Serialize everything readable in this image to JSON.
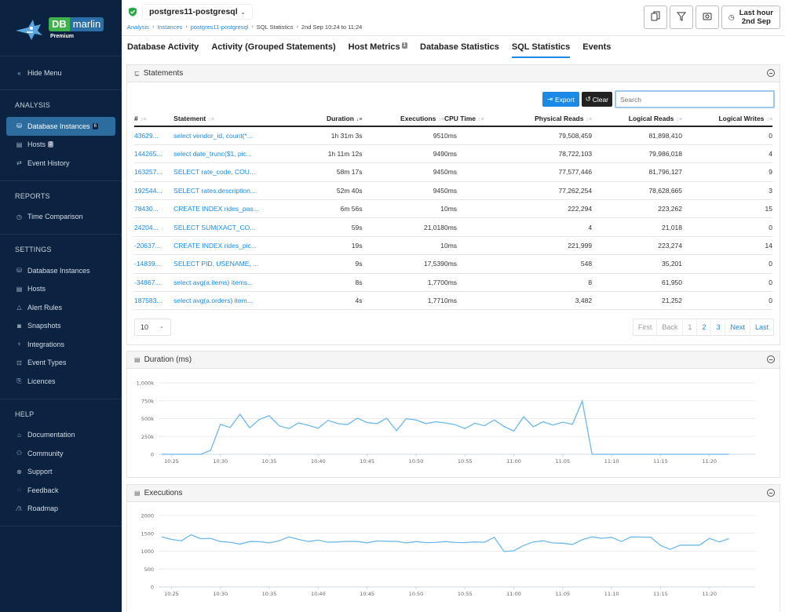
{
  "sidebar": {
    "logo": {
      "db": "DB",
      "marlin": "marlin",
      "tier": "Premium"
    },
    "hide_menu": "Hide Menu",
    "sections": [
      {
        "title": "ANALYSIS",
        "items": [
          {
            "label": "Database Instances",
            "icon": "database-icon",
            "badge": "6",
            "active": true
          },
          {
            "label": "Hosts",
            "icon": "server-icon",
            "badge": "2"
          },
          {
            "label": "Event History",
            "icon": "arrows-exchange-icon"
          }
        ]
      },
      {
        "title": "REPORTS",
        "items": [
          {
            "label": "Time Comparison",
            "icon": "stopwatch-icon"
          }
        ]
      },
      {
        "title": "SETTINGS",
        "items": [
          {
            "label": "Database Instances",
            "icon": "database-icon"
          },
          {
            "label": "Hosts",
            "icon": "server-icon"
          },
          {
            "label": "Alert Rules",
            "icon": "warning-icon"
          },
          {
            "label": "Snapshots",
            "icon": "camera-icon"
          },
          {
            "label": "Integrations",
            "icon": "plug-icon"
          },
          {
            "label": "Event Types",
            "icon": "event-types-icon"
          },
          {
            "label": "Licences",
            "icon": "licence-icon"
          }
        ]
      },
      {
        "title": "HELP",
        "items": [
          {
            "label": "Documentation",
            "icon": "documentation-icon"
          },
          {
            "label": "Community",
            "icon": "community-icon"
          },
          {
            "label": "Support",
            "icon": "globe-icon"
          },
          {
            "label": "Feedback",
            "icon": "chat-icon"
          },
          {
            "label": "Roadmap",
            "icon": "road-icon"
          }
        ]
      }
    ]
  },
  "header": {
    "instance": "postgres11-postgresql",
    "breadcrumb": [
      {
        "label": "Analysis",
        "link": true
      },
      {
        "label": "Instances",
        "link": true
      },
      {
        "label": "postgres11-postgresql",
        "link": true
      },
      {
        "label": "SQL Statistics",
        "link": false
      },
      {
        "label": "2nd Sep 10:24 to 11:24",
        "link": false
      }
    ],
    "time_range": {
      "line1": "Last hour",
      "line2": "2nd Sep"
    }
  },
  "tabs": [
    {
      "label": "Database Activity"
    },
    {
      "label": "Activity (Grouped Statements)"
    },
    {
      "label": "Host Metrics",
      "badge": "1"
    },
    {
      "label": "Database Statistics"
    },
    {
      "label": "SQL Statistics",
      "active": true
    },
    {
      "label": "Events"
    }
  ],
  "statements": {
    "title": "Statements",
    "export_label": "Export",
    "clear_label": "Clear",
    "search_placeholder": "Search",
    "columns": [
      "#",
      "Statement",
      "Duration",
      "Executions",
      "CPU Time",
      "Physical Reads",
      "Logical Reads",
      "Logical Writes"
    ],
    "rows": [
      [
        "43629...",
        "select vendor_id, count(*...",
        "1h 31m 3s",
        "951",
        "0ms",
        "79,508,459",
        "81,898,410",
        "0"
      ],
      [
        "144265...",
        "select date_trunc($1, pic...",
        "1h 11m 12s",
        "949",
        "0ms",
        "78,722,103",
        "79,986,018",
        "4"
      ],
      [
        "163257...",
        "SELECT rate_code, COU...",
        "58m 17s",
        "945",
        "0ms",
        "77,577,446",
        "81,796,127",
        "9"
      ],
      [
        "192544...",
        "SELECT rates.description...",
        "52m 40s",
        "945",
        "0ms",
        "77,262,254",
        "78,628,665",
        "3"
      ],
      [
        "78430...",
        "CREATE INDEX rides_pas...",
        "6m 56s",
        "1",
        "0ms",
        "222,294",
        "223,262",
        "15"
      ],
      [
        "24204...",
        "SELECT SUM(XACT_CO...",
        "59s",
        "21,018",
        "0ms",
        "4",
        "21,018",
        "0"
      ],
      [
        "-20637...",
        "CREATE INDEX rides_pic...",
        "19s",
        "1",
        "0ms",
        "221,999",
        "223,274",
        "14"
      ],
      [
        "-14839...",
        "SELECT PID, USENAME, ...",
        "9s",
        "17,539",
        "0ms",
        "548",
        "35,201",
        "0"
      ],
      [
        "-34867...",
        "select avg(a.items) items...",
        "8s",
        "1,770",
        "0ms",
        "8",
        "61,950",
        "0"
      ],
      [
        "187583...",
        "select avg(a.orders) item...",
        "4s",
        "1,771",
        "0ms",
        "3,482",
        "21,252",
        "0"
      ]
    ],
    "page_size": "10",
    "pager": [
      {
        "label": "First",
        "disabled": true
      },
      {
        "label": "Back",
        "disabled": true
      },
      {
        "label": "1",
        "disabled": true
      },
      {
        "label": "2"
      },
      {
        "label": "3"
      },
      {
        "label": "Next"
      },
      {
        "label": "Last"
      }
    ]
  },
  "colors": {
    "accent": "#1a8ae6",
    "sidebar": "#0b2341",
    "line": "#6cb8ea"
  },
  "chart_data": [
    {
      "type": "line",
      "title": "Duration (ms)",
      "x_start": "10:24",
      "x_step_minutes": 1,
      "xticks": [
        "10:25",
        "10:30",
        "10:35",
        "10:40",
        "10:45",
        "10:50",
        "10:55",
        "11:00",
        "11:05",
        "11:10",
        "11:15",
        "11:20"
      ],
      "yticks": [
        "0",
        "250k",
        "500k",
        "750k",
        "1,000k"
      ],
      "ylim": [
        0,
        1000000
      ],
      "grid": true,
      "series": [
        {
          "name": "Duration",
          "values": [
            0,
            0,
            0,
            0,
            0,
            55000,
            420000,
            375000,
            560000,
            370000,
            490000,
            540000,
            400000,
            360000,
            440000,
            405000,
            365000,
            475000,
            430000,
            415000,
            505000,
            445000,
            430000,
            505000,
            330000,
            500000,
            480000,
            430000,
            455000,
            440000,
            415000,
            360000,
            435000,
            400000,
            480000,
            390000,
            325000,
            525000,
            385000,
            455000,
            410000,
            450000,
            420000,
            745000,
            0,
            0,
            0,
            0,
            0,
            0,
            0,
            0,
            0,
            0,
            0,
            0,
            0,
            0,
            0
          ]
        }
      ]
    },
    {
      "type": "line",
      "title": "Executions",
      "x_start": "10:24",
      "x_step_minutes": 1,
      "xticks": [
        "10:25",
        "10:30",
        "10:35",
        "10:40",
        "10:45",
        "10:50",
        "10:55",
        "11:00",
        "11:05",
        "11:10",
        "11:15",
        "11:20"
      ],
      "yticks": [
        "0",
        "500",
        "1000",
        "1500",
        "2000"
      ],
      "ylim": [
        0,
        2000
      ],
      "grid": true,
      "series": [
        {
          "name": "Executions",
          "values": [
            1400,
            1330,
            1290,
            1460,
            1350,
            1360,
            1270,
            1250,
            1200,
            1270,
            1265,
            1230,
            1290,
            1400,
            1330,
            1270,
            1310,
            1250,
            1260,
            1275,
            1270,
            1235,
            1285,
            1280,
            1275,
            1230,
            1270,
            1240,
            1245,
            1270,
            1245,
            1240,
            1260,
            1250,
            1390,
            990,
            1010,
            1160,
            1260,
            1290,
            1230,
            1225,
            1190,
            1320,
            1400,
            1360,
            1390,
            1270,
            1400,
            1395,
            1390,
            1160,
            1050,
            1170,
            1170,
            1170,
            1360,
            1260,
            1350
          ]
        }
      ]
    }
  ]
}
